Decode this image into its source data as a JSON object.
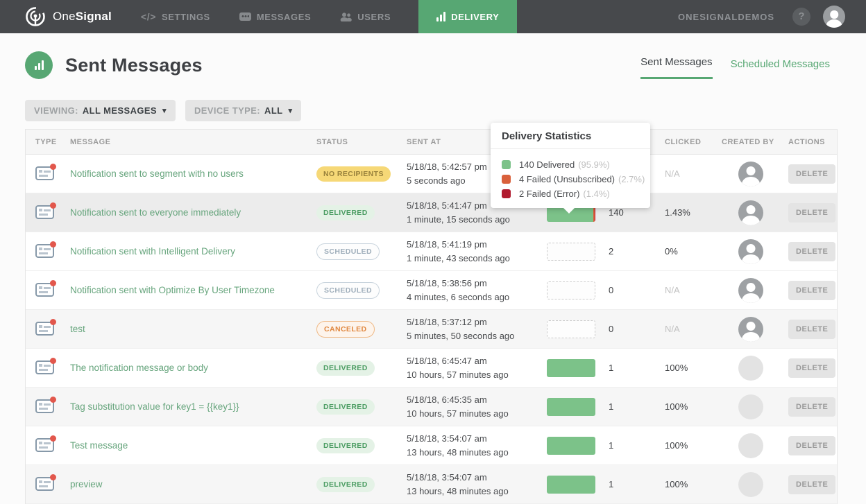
{
  "navbar": {
    "brand": {
      "part1": "One",
      "part2": "Signal"
    },
    "items": [
      {
        "label": "SETTINGS",
        "icon": "code-icon",
        "active": false
      },
      {
        "label": "MESSAGES",
        "icon": "chat-icon",
        "active": false
      },
      {
        "label": "USERS",
        "icon": "users-icon",
        "active": false
      },
      {
        "label": "DELIVERY",
        "icon": "bar-chart-icon",
        "active": true
      }
    ],
    "account": "ONESIGNALDEMOS",
    "help": "?"
  },
  "header": {
    "title": "Sent Messages",
    "tabs": [
      {
        "label": "Sent Messages",
        "active": true
      },
      {
        "label": "Scheduled Messages",
        "active": false
      }
    ]
  },
  "filters": {
    "viewing": {
      "label": "VIEWING:",
      "value": "ALL MESSAGES",
      "caret": "▾"
    },
    "device_type": {
      "label": "DEVICE TYPE:",
      "value": "ALL",
      "caret": "▾"
    }
  },
  "tooltip": {
    "title": "Delivery Statistics",
    "items": [
      {
        "label": "140 Delivered",
        "percent": "(95.9%)",
        "color": "#7CC289"
      },
      {
        "label": "4 Failed (Unsubscribed)",
        "percent": "(2.7%)",
        "color": "#D9603B"
      },
      {
        "label": "2 Failed (Error)",
        "percent": "(1.4%)",
        "color": "#B01A2E"
      }
    ]
  },
  "table": {
    "headers": [
      "TYPE",
      "MESSAGE",
      "STATUS",
      "SENT AT",
      "",
      "CLICKED",
      "CREATED BY",
      "ACTIONS"
    ],
    "delete_label": "DELETE",
    "rows": [
      {
        "message": "Notification sent to segment with no users",
        "status": "NO RECIPIENTS",
        "sent_date": "5/18/18, 5:42:57 pm",
        "sent_ago": "5 seconds ago",
        "delivered": "",
        "clicked": "N/A"
      },
      {
        "message": "Notification sent to everyone immediately",
        "status": "DELIVERED",
        "sent_date": "5/18/18, 5:41:47 pm",
        "sent_ago": "1 minute, 15 seconds ago",
        "delivered": "140",
        "clicked": "1.43%"
      },
      {
        "message": "Notification sent with Intelligent Delivery",
        "status": "SCHEDULED",
        "sent_date": "5/18/18, 5:41:19 pm",
        "sent_ago": "1 minute, 43 seconds ago",
        "delivered": "2",
        "clicked": "0%"
      },
      {
        "message": "Notification sent with Optimize By User Timezone",
        "status": "SCHEDULED",
        "sent_date": "5/18/18, 5:38:56 pm",
        "sent_ago": "4 minutes, 6 seconds ago",
        "delivered": "0",
        "clicked": "N/A"
      },
      {
        "message": "test",
        "status": "CANCELED",
        "sent_date": "5/18/18, 5:37:12 pm",
        "sent_ago": "5 minutes, 50 seconds ago",
        "delivered": "0",
        "clicked": "N/A"
      },
      {
        "message": "The notification message or body",
        "status": "DELIVERED",
        "sent_date": "5/18/18, 6:45:47 am",
        "sent_ago": "10 hours, 57 minutes ago",
        "delivered": "1",
        "clicked": "100%"
      },
      {
        "message": "Tag substitution value for key1 = {{key1}}",
        "status": "DELIVERED",
        "sent_date": "5/18/18, 6:45:35 am",
        "sent_ago": "10 hours, 57 minutes ago",
        "delivered": "1",
        "clicked": "100%"
      },
      {
        "message": "Test message",
        "status": "DELIVERED",
        "sent_date": "5/18/18, 3:54:07 am",
        "sent_ago": "13 hours, 48 minutes ago",
        "delivered": "1",
        "clicked": "100%"
      },
      {
        "message": "preview",
        "status": "DELIVERED",
        "sent_date": "5/18/18, 3:54:07 am",
        "sent_ago": "13 hours, 48 minutes ago",
        "delivered": "1",
        "clicked": "100%"
      }
    ]
  },
  "colors": {
    "accent_green": "#57A773",
    "delivered_bar": "#7CC289",
    "failed_unsubscribed": "#D9603B",
    "failed_error": "#B01A2E",
    "navbar_bg": "#47494C"
  }
}
